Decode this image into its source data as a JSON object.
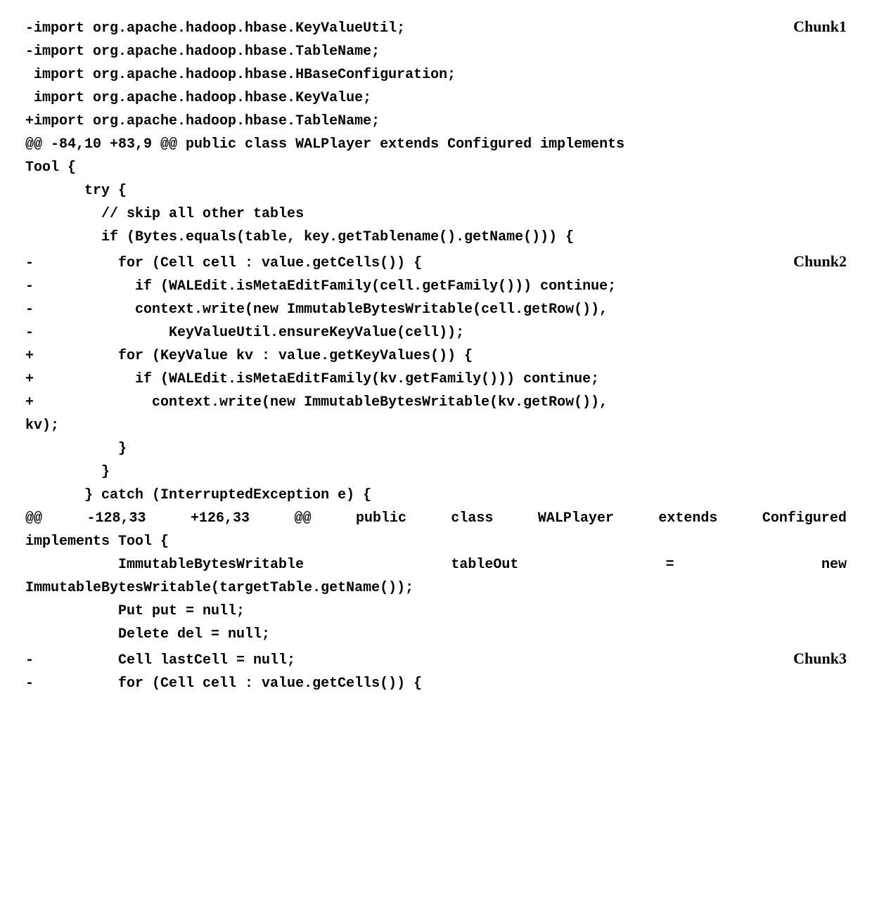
{
  "labels": {
    "chunk1": "Chunk1",
    "chunk2": "Chunk2",
    "chunk3": "Chunk3"
  },
  "diff": {
    "l01": "-import org.apache.hadoop.hbase.KeyValueUtil;",
    "l02": "-import org.apache.hadoop.hbase.TableName;",
    "l03": " import org.apache.hadoop.hbase.HBaseConfiguration;",
    "l04": " import org.apache.hadoop.hbase.KeyValue;",
    "l05": "+import org.apache.hadoop.hbase.TableName;",
    "l06": "@@ -84,10 +83,9 @@ public class WALPlayer extends Configured implements",
    "l07": "Tool {",
    "l08": "       try {",
    "l09": "         // skip all other tables",
    "l10": "         if (Bytes.equals(table, key.getTablename().getName())) {",
    "l11": "-          for (Cell cell : value.getCells()) {",
    "l12": "-            if (WALEdit.isMetaEditFamily(cell.getFamily())) continue;",
    "l13": "-            context.write(new ImmutableBytesWritable(cell.getRow()),",
    "l14": "-                KeyValueUtil.ensureKeyValue(cell));",
    "l15": "+          for (KeyValue kv : value.getKeyValues()) {",
    "l16": "+            if (WALEdit.isMetaEditFamily(kv.getFamily())) continue;",
    "l17": "+              context.write(new ImmutableBytesWritable(kv.getRow()),",
    "l18": "kv);",
    "l19": "           }",
    "l20": "         }",
    "l21": "       } catch (InterruptedException e) {",
    "l22_words": [
      "@@",
      "-128,33",
      "+126,33",
      "@@",
      "public",
      "class",
      "WALPlayer",
      "extends",
      "Configured"
    ],
    "l23": "implements Tool {",
    "l24_words": [
      "           ImmutableBytesWritable",
      "tableOut",
      "=",
      "new"
    ],
    "l25": "ImmutableBytesWritable(targetTable.getName());",
    "l26": "           Put put = null;",
    "l27": "           Delete del = null;",
    "l28": "-          Cell lastCell = null;",
    "l29": "-          for (Cell cell : value.getCells()) {"
  }
}
